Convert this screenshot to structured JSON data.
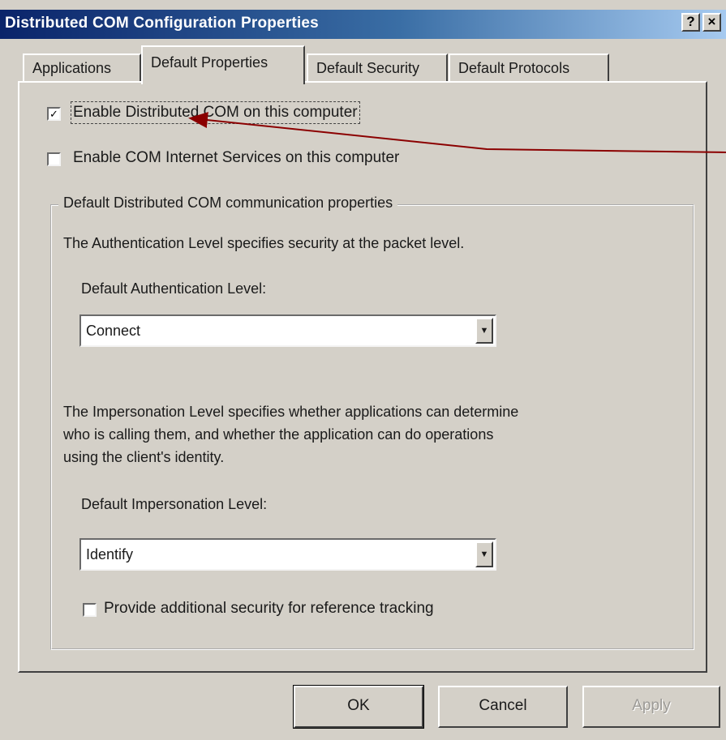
{
  "window": {
    "title": "Distributed COM Configuration Properties",
    "help_button": "?",
    "close_button": "×"
  },
  "tabs": [
    {
      "label": "Applications",
      "active": false
    },
    {
      "label": "Default Properties",
      "active": true
    },
    {
      "label": "Default Security",
      "active": false
    },
    {
      "label": "Default Protocols",
      "active": false
    }
  ],
  "options": {
    "enable_dcom": {
      "label": "Enable Distributed COM on this computer",
      "checked": true
    },
    "enable_cis": {
      "label": "Enable COM Internet Services on this computer",
      "checked": false
    }
  },
  "group": {
    "title": "Default Distributed COM communication properties",
    "auth_description": "The Authentication Level specifies security at the packet level.",
    "auth_label": "Default Authentication Level:",
    "auth_value": "Connect",
    "imp_description_lines": [
      "The Impersonation Level specifies whether applications can determine",
      "who is calling them, and whether the application can do operations",
      "using the client's identity."
    ],
    "imp_label": "Default Impersonation Level:",
    "imp_value": "Identify",
    "ref_tracking": {
      "label": "Provide additional security for reference tracking",
      "checked": false
    }
  },
  "buttons": {
    "ok": "OK",
    "cancel": "Cancel",
    "apply": "Apply"
  },
  "colors": {
    "dialog_face": "#d4d0c8",
    "title_active": "#0a246a",
    "annotation_arrow": "#8b0000"
  }
}
